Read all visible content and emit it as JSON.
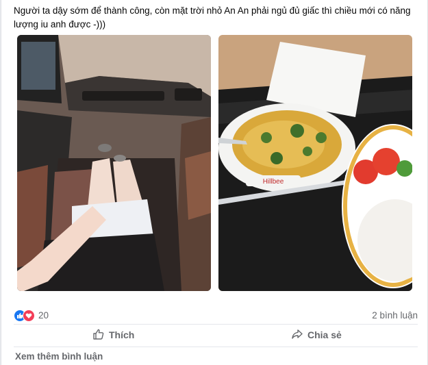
{
  "post": {
    "text": "Người ta dậy sớm để thành công, còn mặt trời nhỏ An An phải ngủ đủ giấc thì chiều mới có năng lượng iu anh được -)))"
  },
  "photo_labels": {
    "bowl_brand": "Hillbee"
  },
  "reactions": {
    "icons": [
      "like-icon",
      "love-icon"
    ],
    "count": "20"
  },
  "comments": {
    "count_label": "2 bình luận",
    "more_label": "Xem thêm bình luận"
  },
  "actions": {
    "like_label": "Thích",
    "share_label": "Chia sẻ"
  },
  "colors": {
    "like_blue": "#1877f2",
    "love_red": "#f33e58",
    "muted_text": "#65676b"
  }
}
